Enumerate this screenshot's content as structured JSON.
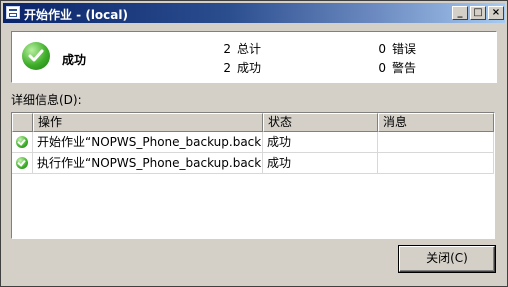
{
  "window": {
    "title": "开始作业 - (local)"
  },
  "titlebar_buttons": {
    "minimize": "_",
    "maximize": "□",
    "close": "×"
  },
  "summary": {
    "status": "成功",
    "total_count": "2",
    "total_label": "总计",
    "success_count": "2",
    "success_label": "成功",
    "error_count": "0",
    "error_label": "错误",
    "warning_count": "0",
    "warning_label": "警告"
  },
  "details": {
    "label": "详细信息(D):",
    "columns": [
      "操作",
      "状态",
      "消息"
    ],
    "rows": [
      {
        "action": "开始作业“NOPWS_Phone_backup.back...",
        "status": "成功",
        "message": ""
      },
      {
        "action": "执行作业“NOPWS_Phone_backup.back...",
        "status": "成功",
        "message": ""
      }
    ]
  },
  "buttons": {
    "close": "关闭(C)"
  }
}
